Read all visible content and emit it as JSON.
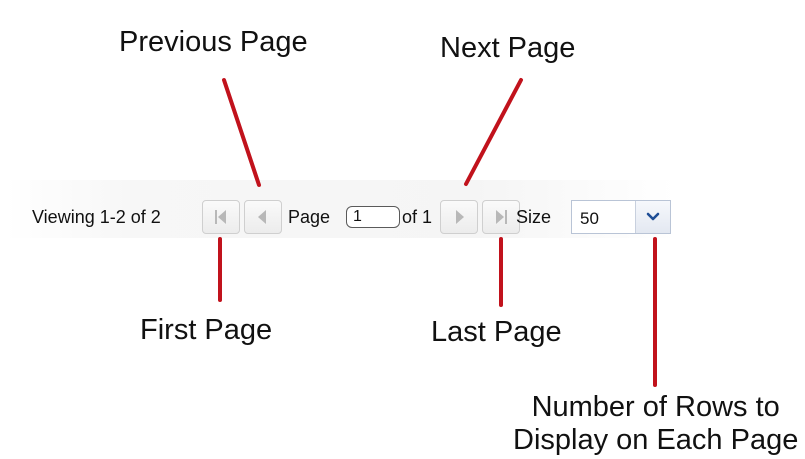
{
  "pager": {
    "viewing_text": "Viewing 1-2 of 2",
    "page_label": "Page",
    "page_value": "1",
    "of_text": "of 1",
    "size_label": "Size",
    "size_value": "50"
  },
  "icons": {
    "first": "first-page-icon",
    "prev": "previous-page-icon",
    "next": "next-page-icon",
    "last": "last-page-icon",
    "dropdown": "chevron-down-icon"
  },
  "callouts": {
    "previous": "Previous Page",
    "next": "Next Page",
    "first": "First Page",
    "last": "Last Page",
    "rows_line1": "Number of Rows to",
    "rows_line2": "Display on Each Page"
  },
  "colors": {
    "leader_line": "#c1121c",
    "disabled_icon": "#b8b8b8",
    "dropdown_arrow": "#1f4e96"
  }
}
